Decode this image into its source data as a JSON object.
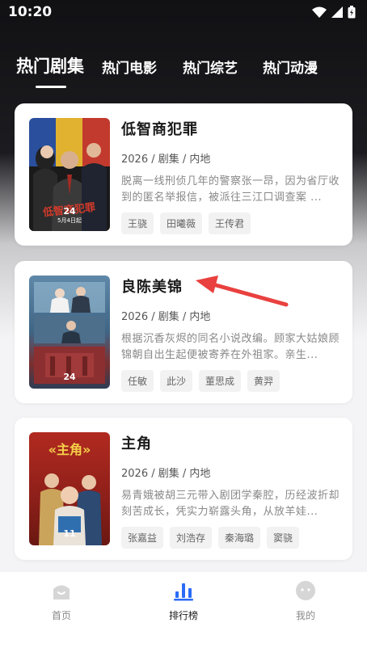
{
  "status": {
    "time": "10:20"
  },
  "tabs": [
    {
      "label": "热门剧集",
      "active": true
    },
    {
      "label": "热门电影",
      "active": false
    },
    {
      "label": "热门综艺",
      "active": false
    },
    {
      "label": "热门动漫",
      "active": false
    }
  ],
  "cards": [
    {
      "title": "低智商犯罪",
      "meta": "2026 / 剧集 / 内地",
      "desc": "脱离一线刑侦几年的警察张一昂，因为省厅收到的匿名举报信，被派往三江口调查案 ...",
      "tags": [
        "王骁",
        "田曦薇",
        "王传君"
      ],
      "poster_number": "24",
      "poster_date": "5月4日起"
    },
    {
      "title": "良陈美锦",
      "meta": "2026 / 剧集 / 内地",
      "desc": "根据沉香灰烬的同名小说改编。顾家大姑娘顾锦朝自出生起便被寄养在外祖家。亲生...",
      "tags": [
        "任敏",
        "此沙",
        "董思成",
        "黄羿"
      ],
      "poster_number": "24"
    },
    {
      "title": "主角",
      "meta": "2026 / 剧集 / 内地",
      "desc": "易青娥被胡三元带入剧团学秦腔，历经波折却刻苦成长，凭实力崭露头角，从放羊娃...",
      "tags": [
        "张嘉益",
        "刘浩存",
        "秦海璐",
        "窦骁"
      ],
      "poster_number": "11",
      "poster_text": "«主角»"
    }
  ],
  "bottom_nav": [
    {
      "label": "首页",
      "icon": "home-icon",
      "active": false
    },
    {
      "label": "排行榜",
      "icon": "ranking-icon",
      "active": true
    },
    {
      "label": "我的",
      "icon": "profile-icon",
      "active": false
    }
  ],
  "colors": {
    "accent": "#2b6cf6",
    "arrow": "#e8413f"
  }
}
